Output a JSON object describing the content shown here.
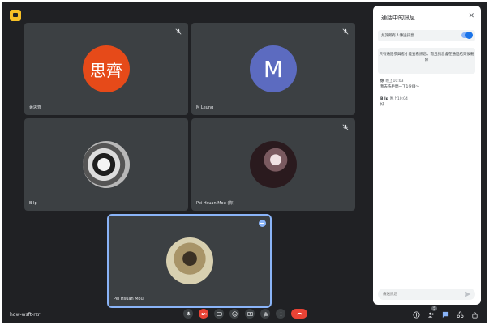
{
  "meeting": {
    "code": "hqw-wsft-rzr"
  },
  "participants": [
    {
      "name": "黃思齊",
      "avatar_text": "思齊",
      "avatar_color": "#e64a19",
      "muted": true
    },
    {
      "name": "M Leung",
      "avatar_text": "M",
      "avatar_color": "#5c6bc0",
      "muted": true
    },
    {
      "name": "B Ip",
      "avatar_text": "",
      "avatar_kind": "cat-photo",
      "muted": false
    },
    {
      "name": "Pei Hsuan Mou (你)",
      "avatar_text": "",
      "avatar_kind": "animal-photo",
      "muted": true
    },
    {
      "name": "Pei Hsuan Mou",
      "avatar_text": "",
      "avatar_kind": "person-photo",
      "muted": false,
      "active": true
    }
  ],
  "chat": {
    "title": "通話中的訊息",
    "toggle_label": "允許所有人傳送訊息",
    "toggle_on": true,
    "notice": "只有通話參與者才能查看訊息，而且訊息會在通話結束後刪除",
    "messages": [
      {
        "sender": "你",
        "time": "晚上10:03",
        "text": "我去洗手間一下1分鐘～"
      },
      {
        "sender": "B Ip",
        "time": "晚上10:04",
        "text": "好"
      }
    ],
    "input_placeholder": "傳送訊息"
  },
  "toolbar": {
    "participant_count": "5",
    "controls": [
      "mic-icon",
      "camera-off-icon",
      "captions-icon",
      "emoji-icon",
      "present-icon",
      "raise-hand-icon",
      "more-options-icon",
      "end-call-icon"
    ],
    "right_icons": [
      "info-icon",
      "people-icon",
      "chat-icon",
      "activities-icon",
      "host-controls-icon"
    ]
  },
  "colors": {
    "background": "#202124",
    "tile": "#3c4043",
    "accent": "#8ab4f8",
    "end_call": "#ea4335"
  }
}
